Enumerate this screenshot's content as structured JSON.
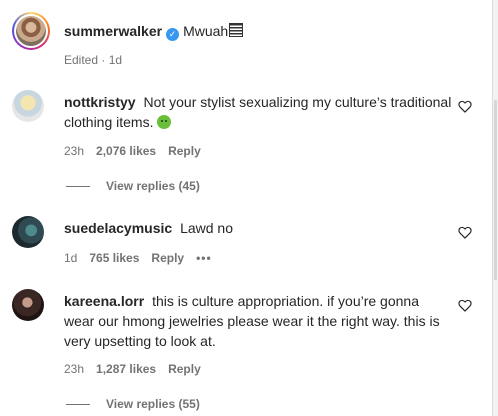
{
  "caption": {
    "username": "summerwalker",
    "text": "Mwuah",
    "meta": "Edited · 1d"
  },
  "comments": [
    {
      "username": "nottkristyy",
      "text": "Not your stylist sexualizing my culture’s traditional clothing items.",
      "time": "23h",
      "likes": "2,076 likes",
      "reply": "Reply",
      "view_replies": "View replies (45)"
    },
    {
      "username": "suedelacymusic",
      "text": "Lawd no",
      "time": "1d",
      "likes": "765 likes",
      "reply": "Reply",
      "more": "•••"
    },
    {
      "username": "kareena.lorr",
      "text": "this is culture appropriation. if you’re gonna wear our hmong jewelries please wear it the right way. this is very upsetting to look at.",
      "time": "23h",
      "likes": "1,287 likes",
      "reply": "Reply",
      "view_replies": "View replies (55)"
    }
  ],
  "icons": {
    "verified": "verified-badge-icon",
    "heart": "heart-outline-icon",
    "emoji_caption": "emoji-icon",
    "emoji_comment": "nauseated-face-emoji"
  },
  "colors": {
    "text": "#262626",
    "secondary": "#737373",
    "verified": "#3897f0",
    "divider": "#dbdbdb"
  }
}
